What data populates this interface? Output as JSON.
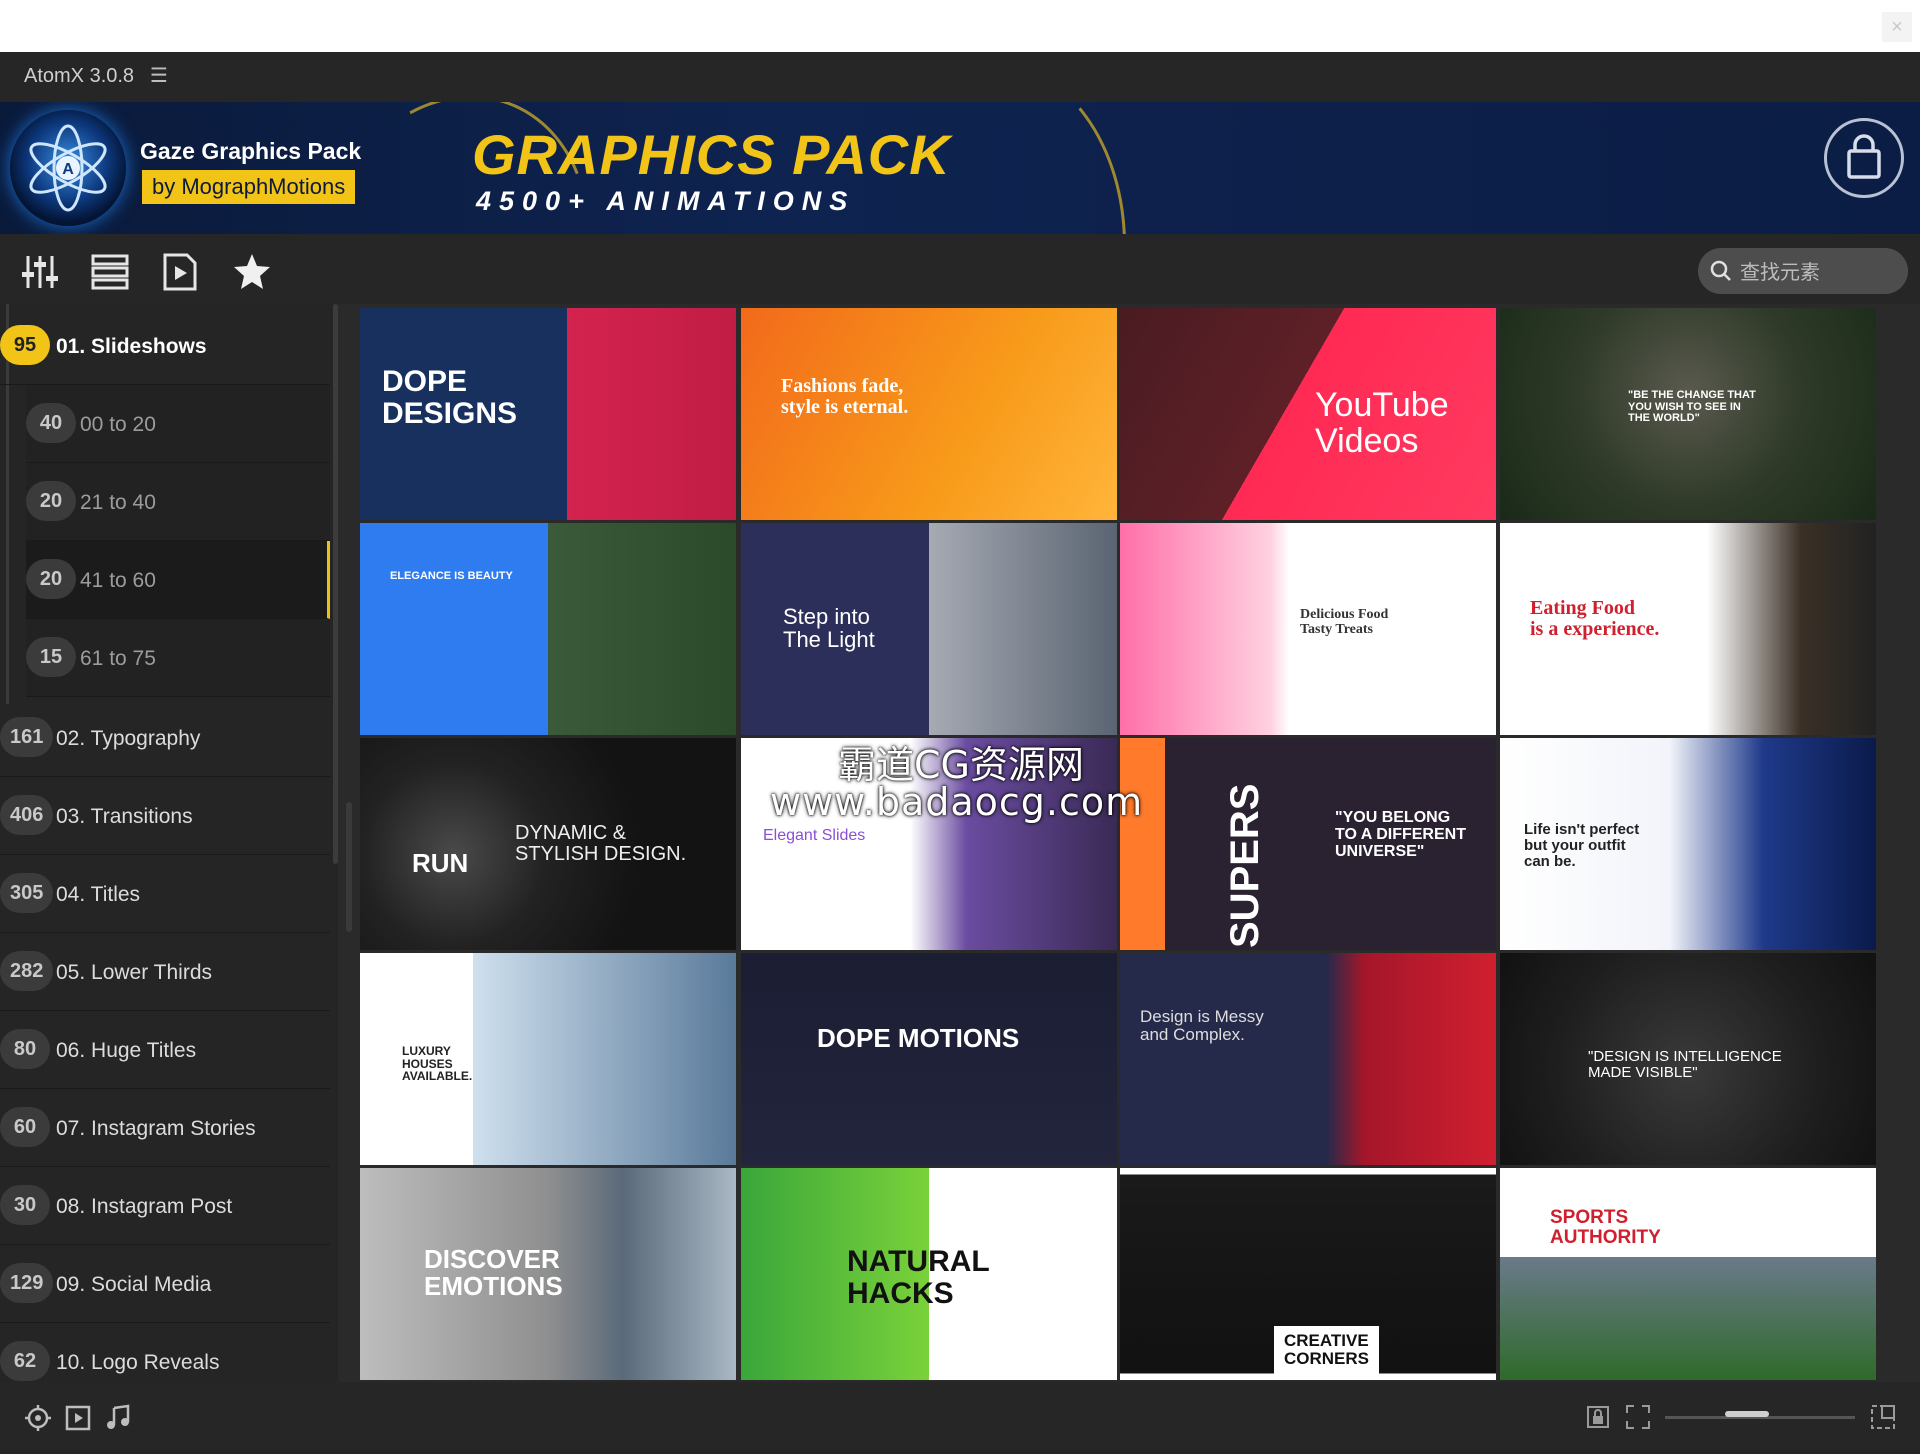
{
  "window": {
    "close_label": "×"
  },
  "app": {
    "title": "AtomX 3.0.8"
  },
  "banner": {
    "pack_name": "Gaze Graphics Pack",
    "pack_by": "by MographMotions",
    "headline": "GRAPHICS PACK",
    "subheadline": "4500+ ANIMATIONS"
  },
  "toolbar": {
    "icons": [
      "mixer-icon",
      "list-view-icon",
      "preview-file-icon",
      "favorites-star-icon"
    ],
    "search_placeholder": "查找元素"
  },
  "sidebar": {
    "items": [
      {
        "label": "01. Slideshows",
        "count": "95",
        "level": 0,
        "highlight": true
      },
      {
        "label": "00 to 20",
        "count": "40",
        "level": 1
      },
      {
        "label": "21 to 40",
        "count": "20",
        "level": 1
      },
      {
        "label": "41 to 60",
        "count": "20",
        "level": 1,
        "active": true
      },
      {
        "label": "61 to 75",
        "count": "15",
        "level": 1
      },
      {
        "label": "02. Typography",
        "count": "161",
        "level": 0
      },
      {
        "label": "03. Transitions",
        "count": "406",
        "level": 0
      },
      {
        "label": "04. Titles",
        "count": "305",
        "level": 0
      },
      {
        "label": "05. Lower Thirds",
        "count": "282",
        "level": 0
      },
      {
        "label": "06. Huge Titles",
        "count": "80",
        "level": 0
      },
      {
        "label": "07. Instagram Stories",
        "count": "60",
        "level": 0
      },
      {
        "label": "08. Instagram Post",
        "count": "30",
        "level": 0
      },
      {
        "label": "09. Social Media",
        "count": "129",
        "level": 0
      },
      {
        "label": "10. Logo Reveals",
        "count": "62",
        "level": 0
      }
    ]
  },
  "tiles": [
    {
      "title": "DOPE\nDESIGNS"
    },
    {
      "title": "Fashions fade,\nstyle is eternal."
    },
    {
      "title": "YouTube\nVideos"
    },
    {
      "title": "\"BE THE CHANGE THAT\nYOU WISH TO SEE IN\nTHE WORLD\""
    },
    {
      "title": "ELEGANCE IS BEAUTY"
    },
    {
      "title": "Step into\nThe Light"
    },
    {
      "title": "Delicious Food\nTasty Treats"
    },
    {
      "title": "Eating Food\nis a experience."
    },
    {
      "title": "DYNAMIC &\nSTYLISH DESIGN."
    },
    {
      "title": "Elegant Slides"
    },
    {
      "title": "\"YOU BELONG\nTO A DIFFERENT\nUNIVERSE\""
    },
    {
      "title": "Life isn't perfect\nbut your outfit\ncan be."
    },
    {
      "title": "LUXURY\nHOUSES\nAVAILABLE."
    },
    {
      "title": "DOPE MOTIONS"
    },
    {
      "title": "Design is Messy\nand Complex."
    },
    {
      "title": "\"DESIGN IS INTELLIGENCE\nMADE VISIBLE\""
    },
    {
      "title": "DISCOVER\nEMOTIONS"
    },
    {
      "title": "NATURAL\nHACKS"
    },
    {
      "title": "CREATIVE\nCORNERS"
    },
    {
      "title": "SPORTS\nAUTHORITY"
    }
  ],
  "tile_extras": {
    "supers": "SUPERS",
    "run": "RUN"
  },
  "watermark": {
    "line1": "霸道CG资源网",
    "line2": "www.badaocg.com"
  },
  "bottombar": {
    "left_icons": [
      "target-icon",
      "play-icon",
      "music-icon"
    ],
    "right_icons": [
      "lock-icon",
      "fit-icon",
      "expand-icon"
    ]
  },
  "colors": {
    "accent": "#f2c418",
    "background": "#2a2a2a",
    "panel": "#252525"
  }
}
